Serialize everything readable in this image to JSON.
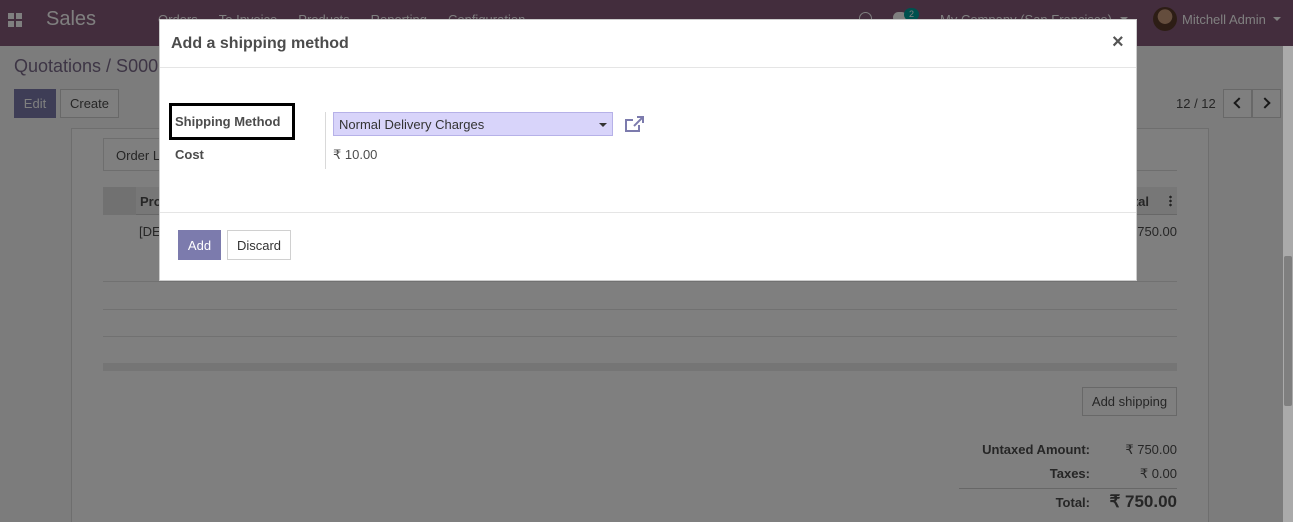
{
  "navbar": {
    "app_name": "Sales",
    "menu": [
      "Orders",
      "To Invoice",
      "Products",
      "Reporting",
      "Configuration"
    ],
    "chat_count": "2",
    "company": "My Company (San Francisco)",
    "user": "Mitchell Admin"
  },
  "control_panel": {
    "breadcrumb": "Quotations / S000",
    "edit_label": "Edit",
    "create_label": "Create",
    "pager": "12 / 12"
  },
  "form": {
    "tab_label": "Order L",
    "columns": {
      "product": "Pro",
      "total": "tal"
    },
    "row": {
      "product": "[DE",
      "total": "750.00"
    },
    "add_shipping_label": "Add shipping",
    "totals": {
      "untaxed_label": "Untaxed Amount:",
      "untaxed_value": "₹ 750.00",
      "taxes_label": "Taxes:",
      "taxes_value": "₹ 0.00",
      "total_label": "Total:",
      "total_value": "₹ 750.00"
    }
  },
  "dialog": {
    "title": "Add a shipping method",
    "close_glyph": "×",
    "shipping_method_label": "Shipping Method",
    "shipping_method_value": "Normal Delivery Charges",
    "cost_label": "Cost",
    "cost_value": "₹ 10.00",
    "add_label": "Add",
    "discard_label": "Discard"
  },
  "colors": {
    "navbar": "#875a7b",
    "primary_button": "#7c7bad",
    "select_highlight": "#d8d4fa",
    "link_icon": "#7c7bad"
  },
  "icons": [
    "apps-grid-icon",
    "clock-icon",
    "chat-icon",
    "chevron-left-icon",
    "chevron-right-icon",
    "external-link-icon",
    "close-icon",
    "caret-down-icon"
  ]
}
